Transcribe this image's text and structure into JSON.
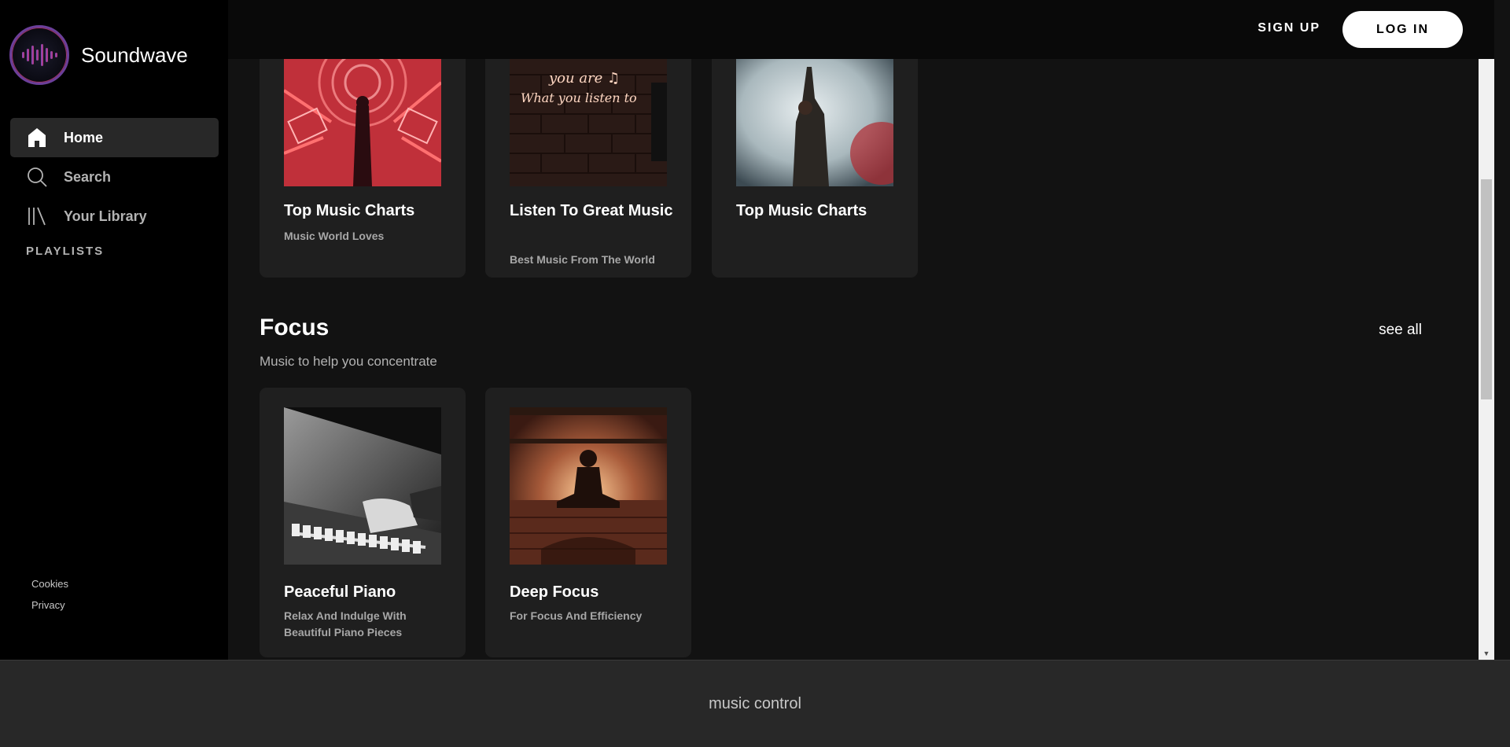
{
  "app": {
    "name": "Soundwave"
  },
  "sidebar": {
    "items": [
      {
        "label": "Home",
        "icon": "home-icon"
      },
      {
        "label": "Search",
        "icon": "search-icon"
      },
      {
        "label": "Your Library",
        "icon": "library-icon"
      }
    ],
    "playlists_label": "PLAYLISTS",
    "footer": [
      "Cookies",
      "Privacy"
    ]
  },
  "topbar": {
    "signup_label": "SIGN UP",
    "login_label": "LOG IN"
  },
  "upper_cards": [
    {
      "title": "Top Music Charts",
      "subtitle": "Music World Loves"
    },
    {
      "title": "Listen To Great Music",
      "subtitle": "Best Music From The World",
      "art_text_1": "you are ♫",
      "art_text_2": "What you listen to"
    },
    {
      "title": "Top Music Charts",
      "subtitle": ""
    }
  ],
  "focus": {
    "title": "Focus",
    "description": "Music to help you concentrate",
    "see_all": "see all",
    "cards": [
      {
        "title": "Peaceful Piano",
        "subtitle": "Relax And Indulge With Beautiful Piano Pieces"
      },
      {
        "title": "Deep Focus",
        "subtitle": "For Focus And Efficiency"
      }
    ]
  },
  "player": {
    "label": "music control"
  },
  "colors": {
    "background": "#121212",
    "sidebar": "#000000",
    "card": "#1f1f1f",
    "player": "#282828",
    "logo_ring": "#6b3f9a"
  }
}
